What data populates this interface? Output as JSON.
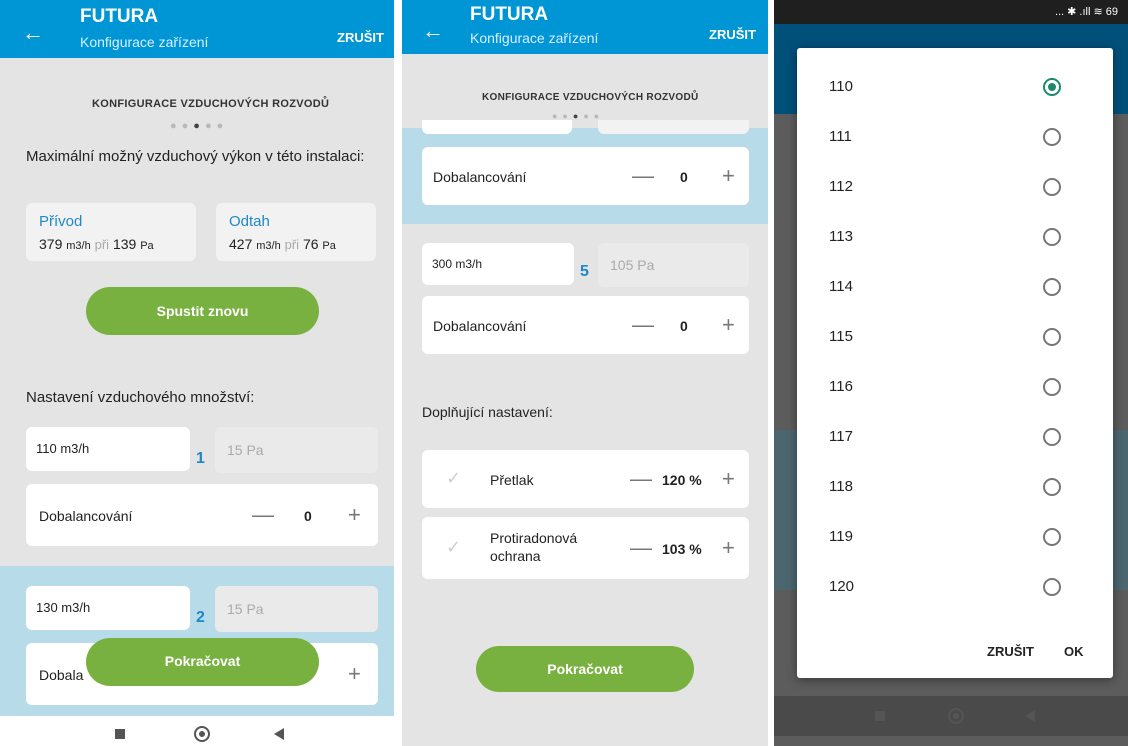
{
  "app": {
    "title": "FUTURA",
    "subtitle": "Konfigurace zařízení",
    "cancel": "ZRUŠIT",
    "back": "←"
  },
  "panel1": {
    "section_title": "KONFIGURACE  VZDUCHOVÝCH ROZVODŮ",
    "heading": "Maximální možný vzduchový výkon v této instalaci:",
    "supply": {
      "label": "Přívod",
      "flow": "379",
      "flow_unit": "m3/h",
      "at": "při",
      "pressure": "139",
      "pressure_unit": "Pa"
    },
    "exhaust": {
      "label": "Odtah",
      "flow": "427",
      "flow_unit": "m3/h",
      "at": "při",
      "pressure": "76",
      "pressure_unit": "Pa"
    },
    "restart_button": "Spustit znovu",
    "settings_heading": "Nastavení vzduchového množství:",
    "rows": [
      {
        "flow": "110 m3/h",
        "index": "1",
        "pressure": "15 Pa",
        "balance_label": "Dobalancování",
        "balance_value": "0"
      },
      {
        "flow": "130 m3/h",
        "index": "2",
        "pressure": "15 Pa",
        "balance_label": "Dobala",
        "balance_value": ""
      }
    ],
    "continue_button": "Pokračovat"
  },
  "panel2": {
    "section_title": "KONFIGURACE  VZDUCHOVÝCH ROZVODŮ",
    "row_prev": {
      "balance_label": "Dobalancování",
      "balance_value": "0"
    },
    "row5": {
      "flow": "300 m3/h",
      "index": "5",
      "pressure": "105 Pa",
      "balance_label": "Dobalancování",
      "balance_value": "0"
    },
    "extra_heading": "Doplňující nastavení:",
    "overpressure": {
      "label": "Přetlak",
      "value": "120 %"
    },
    "radon": {
      "label_line1": "Protiradonová",
      "label_line2": "ochrana",
      "value": "103 %"
    },
    "continue_button": "Pokračovat"
  },
  "panel3": {
    "status": "... ✱ .ıll ≋ 69",
    "options": [
      "110",
      "111",
      "112",
      "113",
      "114",
      "115",
      "116",
      "117",
      "118",
      "119",
      "120"
    ],
    "selected": "110",
    "cancel": "ZRUŠIT",
    "ok": "OK"
  },
  "icons": {
    "minus": "—",
    "plus": "+",
    "check": "✓"
  },
  "colors": {
    "appbar": "#0096d6",
    "accent_green": "#78b13f",
    "accent_blue": "#1e88c8",
    "radio_selected": "#1b8a6b"
  }
}
